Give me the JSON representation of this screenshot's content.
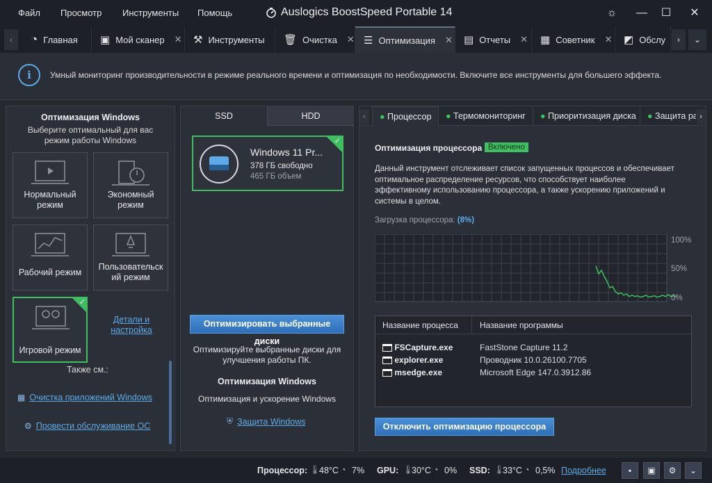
{
  "menu": {
    "file": "Файл",
    "view": "Просмотр",
    "tools": "Инструменты",
    "help": "Помощь"
  },
  "app_title": "Auslogics BoostSpeed Portable 14",
  "tabs": [
    {
      "label": "Главная"
    },
    {
      "label": "Мой сканер"
    },
    {
      "label": "Инструменты"
    },
    {
      "label": "Очистка"
    },
    {
      "label": "Оптимизация"
    },
    {
      "label": "Отчеты"
    },
    {
      "label": "Советник"
    },
    {
      "label": "Обслу"
    }
  ],
  "info_text": "Умный мониторинг производительности в режиме реального времени и оптимизация по необходимости. Включите все инструменты для большего эффекта.",
  "left": {
    "title": "Оптимизация Windows",
    "subtitle_1": "Выберите оптимальный для вас",
    "subtitle_2": "режим работы Windows",
    "modes": [
      {
        "l1": "Нормальный",
        "l2": "режим"
      },
      {
        "l1": "Экономный",
        "l2": "режим"
      },
      {
        "l1": "Рабочий режим",
        "l2": ""
      },
      {
        "l1": "Пользовательск",
        "l2": "ий режим"
      },
      {
        "l1": "Игровой режим",
        "l2": ""
      }
    ],
    "details_1": "Детали и",
    "details_2": "настройка",
    "see_also": "Также см.:",
    "link1": "Очистка приложений Windows",
    "link2": "Провести обслуживание ОС"
  },
  "middle": {
    "tab_ssd": "SSD",
    "tab_hdd": "HDD",
    "disk_name": "Windows  11 Pr...",
    "disk_free": "378 ГБ свободно",
    "disk_total": "465 ГБ объем",
    "button": "Оптимизировать выбранные диски",
    "desc_1": "Оптимизируйте выбранные диски для",
    "desc_2": "улучшения работы ПК.",
    "section_title": "Оптимизация Windows",
    "section_desc": "Оптимизация и ускорение Windows",
    "link": "Защита Windows"
  },
  "right": {
    "tabs": [
      "Процессор",
      "Термомониторинг",
      "Приоритизация диска",
      "Защита ра"
    ],
    "title": "Оптимизация процессора",
    "badge": "Включено",
    "desc": [
      "Данный инструмент отслеживает список запущенных процессов и обеспечивает",
      "оптимальное распределение ресурсов, что способствует наиболее",
      "эффективному использованию процессора, а также ускорению приложений и",
      "системы в целом."
    ],
    "load_label": "Загрузка процессора:",
    "load_value": "(8%)",
    "axis": [
      "100%",
      "50%",
      "0%"
    ],
    "col1": "Название процесса",
    "col2": "Название программы",
    "rows": [
      {
        "proc": "FSCapture.exe",
        "prog": "FastStone Capture 11.2"
      },
      {
        "proc": "explorer.exe",
        "prog": "Проводник 10.0.26100.7705"
      },
      {
        "proc": "msedge.exe",
        "prog": "Microsoft Edge 147.0.3912.86"
      }
    ],
    "button": "Отключить оптимизацию процессора"
  },
  "status": {
    "cpu_label": "Процессор:",
    "cpu_temp": "48°C",
    "cpu_load": "7%",
    "gpu_label": "GPU:",
    "gpu_temp": "30°C",
    "gpu_load": "0%",
    "ssd_label": "SSD:",
    "ssd_temp": "33°C",
    "ssd_load": "0,5%",
    "more": "Подробнее"
  },
  "colors": {
    "accent_green": "#3fbf62",
    "accent_blue": "#5ea9e8"
  }
}
